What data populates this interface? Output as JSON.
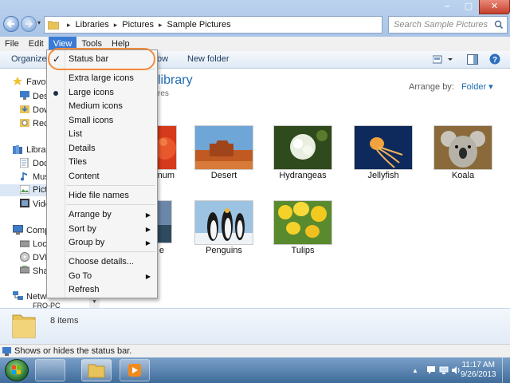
{
  "address": {
    "segments": [
      "Libraries",
      "Pictures",
      "Sample Pictures"
    ]
  },
  "search": {
    "placeholder": "Search Sample Pictures"
  },
  "menubar": {
    "items": [
      "File",
      "Edit",
      "View",
      "Tools",
      "Help"
    ]
  },
  "commandbar": {
    "organize": "Organize",
    "view_partial": "ow",
    "new_folder": "New folder"
  },
  "navpane": {
    "items": [
      "Favori",
      "Desl",
      "Dow",
      "Rece",
      "Librar",
      "Doc",
      "Mus",
      "Pict",
      "Vide",
      "Comp",
      "Loca",
      "DVD",
      "Shar",
      "Netw",
      "FRO-PC"
    ]
  },
  "content": {
    "library_title": "library",
    "library_sub": "res",
    "arrange_by_label": "Arrange by:",
    "arrange_by_value": "Folder"
  },
  "files": [
    {
      "name": "num"
    },
    {
      "name": "Desert"
    },
    {
      "name": "Hydrangeas"
    },
    {
      "name": "Jellyfish"
    },
    {
      "name": "Koala"
    },
    {
      "name": "e"
    },
    {
      "name": "Penguins"
    },
    {
      "name": "Tulips"
    }
  ],
  "view_menu": {
    "status_bar": "Status bar",
    "extra_large_icons": "Extra large icons",
    "large_icons": "Large icons",
    "medium_icons": "Medium icons",
    "small_icons": "Small icons",
    "list": "List",
    "details": "Details",
    "tiles": "Tiles",
    "content": "Content",
    "hide_file_names": "Hide file names",
    "arrange_by": "Arrange by",
    "sort_by": "Sort by",
    "group_by": "Group by",
    "choose_details": "Choose details...",
    "go_to": "Go To",
    "refresh": "Refresh"
  },
  "details_pane": {
    "count": "8 items"
  },
  "statusbar": {
    "text": "Shows or hides the status bar."
  },
  "clock": {
    "time": "11:17 AM",
    "date": "9/26/2013"
  },
  "colors": {
    "accent": "#1f6db5",
    "menu_active": "#3a7bd5",
    "ring": "#f08a3c"
  }
}
